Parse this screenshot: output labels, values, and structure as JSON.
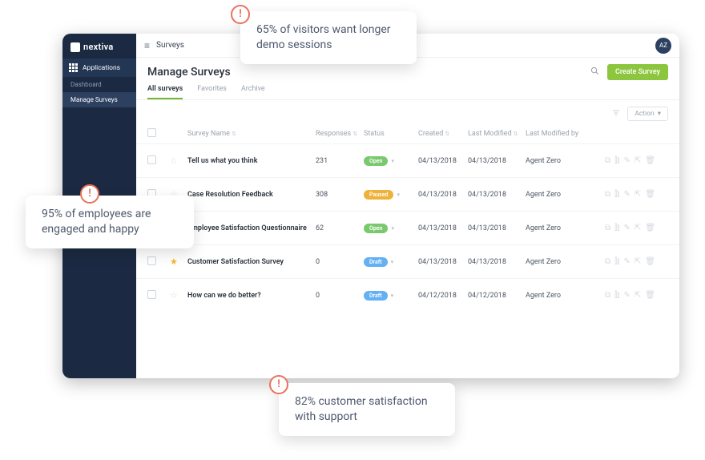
{
  "brand": {
    "name": "nextiva"
  },
  "sidebar": {
    "applications_label": "Applications",
    "items": [
      "Dashboard",
      "Manage Surveys"
    ],
    "active_index": 1
  },
  "breadcrumb": {
    "icon": "≡",
    "label": "Surveys"
  },
  "user": {
    "initials": "AZ"
  },
  "page": {
    "title": "Manage Surveys",
    "create_button": "Create Survey",
    "action_button": "Action"
  },
  "tabs": {
    "items": [
      "All surveys",
      "Favorites",
      "Archive"
    ],
    "active_index": 0
  },
  "columns": {
    "name": "Survey Name",
    "responses": "Responses",
    "status": "Status",
    "created": "Created",
    "modified": "Last Modified",
    "modified_by": "Last Modified by"
  },
  "status_labels": {
    "open": "Open",
    "paused": "Paused",
    "draft": "Draft"
  },
  "rows": [
    {
      "star": false,
      "name": "Tell us what you think",
      "responses": 231,
      "status": "open",
      "created": "04/13/2018",
      "modified": "04/13/2018",
      "modified_by": "Agent Zero"
    },
    {
      "star": false,
      "name": "Case Resolution Feedback",
      "responses": 308,
      "status": "paused",
      "created": "04/13/2018",
      "modified": "04/13/2018",
      "modified_by": "Agent Zero"
    },
    {
      "star": false,
      "name": "Employee Satisfaction Questionnaire",
      "responses": 62,
      "status": "open",
      "created": "04/13/2018",
      "modified": "04/13/2018",
      "modified_by": "Agent Zero"
    },
    {
      "star": true,
      "name": "Customer Satisfaction Survey",
      "responses": 0,
      "status": "draft",
      "created": "04/13/2018",
      "modified": "04/13/2018",
      "modified_by": "Agent Zero"
    },
    {
      "star": false,
      "name": "How can we do better?",
      "responses": 0,
      "status": "draft",
      "created": "04/12/2018",
      "modified": "04/12/2018",
      "modified_by": "Agent Zero"
    }
  ],
  "callouts": [
    "65% of visitors want longer demo sessions",
    "95% of employees are engaged and happy",
    "82% customer satisfaction with support"
  ]
}
